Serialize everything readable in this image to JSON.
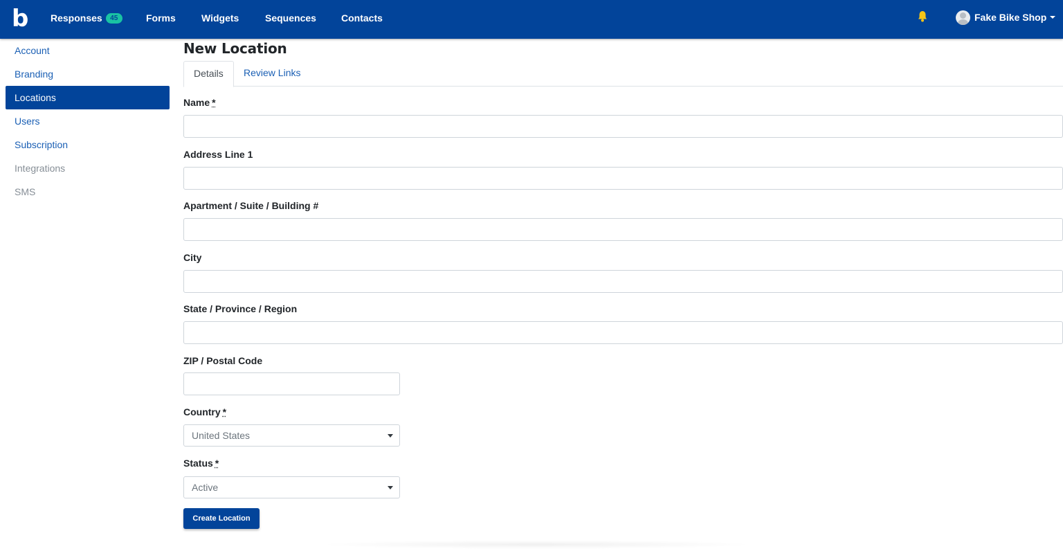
{
  "brand": {
    "logo_letter": "b",
    "nav_color": "#02449a",
    "badge_color": "#19c3a3"
  },
  "nav": {
    "items": [
      {
        "label": "Responses",
        "badge": "45"
      },
      {
        "label": "Forms"
      },
      {
        "label": "Widgets"
      },
      {
        "label": "Sequences"
      },
      {
        "label": "Contacts"
      }
    ],
    "bell_icon": "bell-icon",
    "user": {
      "name": "Fake Bike Shop",
      "avatar_icon": "user-avatar-icon"
    }
  },
  "sidebar": {
    "items": [
      {
        "label": "Account"
      },
      {
        "label": "Branding"
      },
      {
        "label": "Locations",
        "active": true
      },
      {
        "label": "Users"
      },
      {
        "label": "Subscription"
      },
      {
        "label": "Integrations"
      },
      {
        "label": "SMS"
      }
    ]
  },
  "page": {
    "title": "New Location",
    "tabs": [
      {
        "label": "Details",
        "active": true
      },
      {
        "label": "Review Links"
      }
    ]
  },
  "form": {
    "required_marker": "*",
    "fields": [
      {
        "label": "Name",
        "required": true,
        "value": ""
      },
      {
        "label": "Address Line 1",
        "value": ""
      },
      {
        "label": "Apartment / Suite / Building #",
        "value": ""
      },
      {
        "label": "City",
        "value": ""
      },
      {
        "label": "State / Province / Region",
        "value": ""
      },
      {
        "label": "ZIP / Postal Code",
        "value": ""
      }
    ],
    "country": {
      "label": "Country",
      "required": true,
      "selected": "United States"
    },
    "status": {
      "label": "Status",
      "required": true,
      "selected": "Active"
    },
    "submit_label": "Create Location"
  }
}
